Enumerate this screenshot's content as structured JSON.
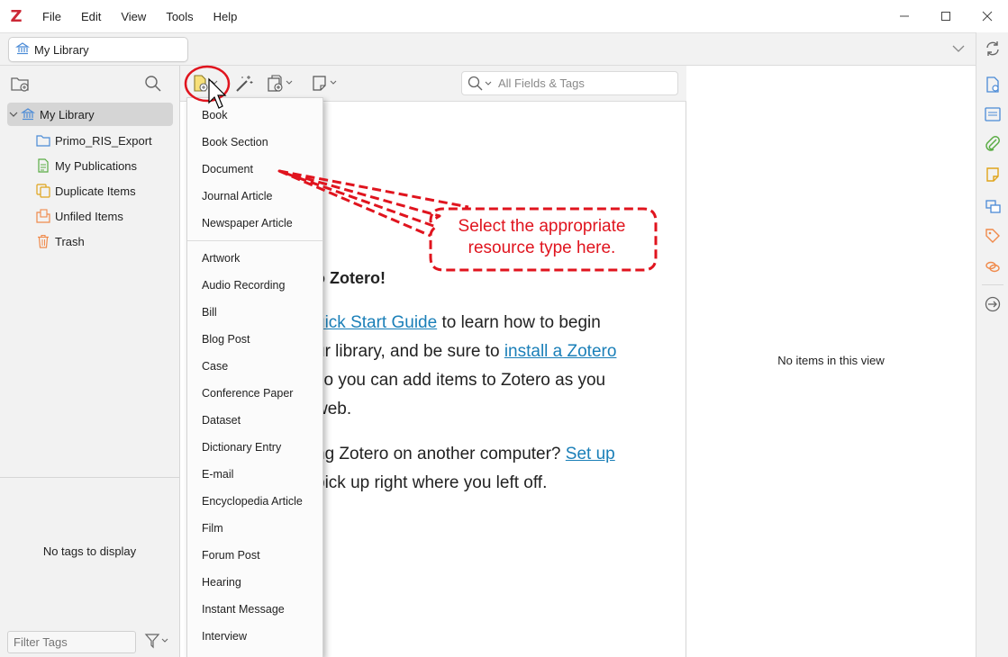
{
  "app": {
    "logo": "Z"
  },
  "menu": [
    "File",
    "Edit",
    "View",
    "Tools",
    "Help"
  ],
  "tab": {
    "label": "My Library"
  },
  "collections": {
    "items": [
      {
        "label": "My Library",
        "icon": "library-icon"
      },
      {
        "label": "Primo_RIS_Export",
        "icon": "folder-icon"
      },
      {
        "label": "My Publications",
        "icon": "publications-icon"
      },
      {
        "label": "Duplicate Items",
        "icon": "duplicate-icon"
      },
      {
        "label": "Unfiled Items",
        "icon": "unfiled-icon"
      },
      {
        "label": "Trash",
        "icon": "trash-icon"
      }
    ]
  },
  "tags": {
    "empty": "No tags to display",
    "filter_placeholder": "Filter Tags"
  },
  "search": {
    "placeholder": "All Fields & Tags"
  },
  "welcome": {
    "heading": "o Zotero!",
    "line1_pre": "",
    "line1_link": "uick Start Guide",
    "line1_post": " to learn how to begin",
    "line2_pre": "ur library, and be sure to ",
    "line2_link": "install a Zotero",
    "line3": "so you can add items to Zotero as you",
    "line4": " web.",
    "line5_pre": "ng Zotero on another computer? ",
    "line5_link": "Set up",
    "line6": "pick up right where you left off."
  },
  "item_pane": {
    "empty": "No items in this view"
  },
  "dropdown": {
    "recent": [
      "Book",
      "Book Section",
      "Document",
      "Journal Article",
      "Newspaper Article"
    ],
    "all": [
      "Artwork",
      "Audio Recording",
      "Bill",
      "Blog Post",
      "Case",
      "Conference Paper",
      "Dataset",
      "Dictionary Entry",
      "E-mail",
      "Encyclopedia Article",
      "Film",
      "Forum Post",
      "Hearing",
      "Instant Message",
      "Interview"
    ]
  },
  "callout": {
    "line1": "Select the appropriate",
    "line2": "resource type here."
  },
  "colors": {
    "accent": "#cc2936",
    "annotation": "#e0141e",
    "link": "#1a7fb8",
    "icon_blue": "#4a8ad6"
  }
}
